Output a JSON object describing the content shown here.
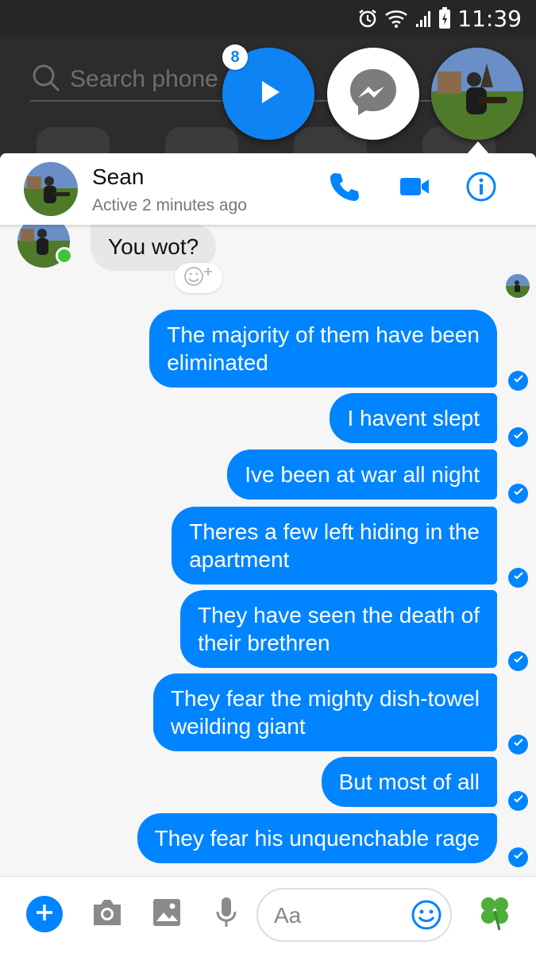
{
  "status_bar": {
    "time": "11:39"
  },
  "background_app": {
    "search_placeholder": "Search phone"
  },
  "chat_heads": {
    "unread_count": "8"
  },
  "conversation": {
    "contact_name": "Sean",
    "active_status": "Active 2 minutes ago"
  },
  "messages": {
    "incoming": [
      "You wot?"
    ],
    "outgoing": [
      "The majority of them have been\neliminated",
      "I havent slept",
      "Ive been at war all night",
      "Theres a few left hiding in the\napartment",
      "They have seen the death of\ntheir brethren",
      "They fear the mighty dish-towel\nweilding giant",
      "But most of all",
      "They fear his unquenchable rage"
    ]
  },
  "composer": {
    "placeholder": "Aa"
  },
  "colors": {
    "accent": "#0084ff",
    "online": "#3cc43c",
    "incoming_bubble": "#e7e7e7"
  },
  "icons": [
    "alarm-icon",
    "wifi-icon",
    "signal-icon",
    "battery-icon",
    "search-icon",
    "play-icon",
    "messenger-icon",
    "phone-icon",
    "video-camera-icon",
    "info-icon",
    "add-reaction-icon",
    "check-icon",
    "plus-icon",
    "camera-icon",
    "image-icon",
    "microphone-icon",
    "emoji-icon",
    "clover-icon"
  ]
}
